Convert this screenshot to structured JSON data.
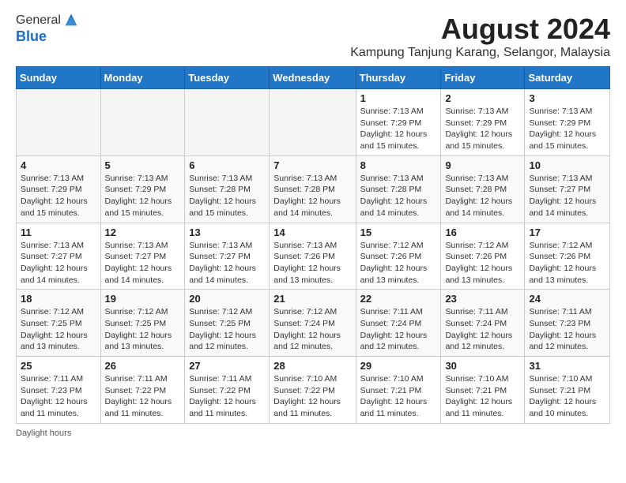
{
  "header": {
    "logo_general": "General",
    "logo_blue": "Blue",
    "title": "August 2024",
    "subtitle": "Kampung Tanjung Karang, Selangor, Malaysia"
  },
  "days_of_week": [
    "Sunday",
    "Monday",
    "Tuesday",
    "Wednesday",
    "Thursday",
    "Friday",
    "Saturday"
  ],
  "footer": {
    "daylight_label": "Daylight hours"
  },
  "weeks": [
    [
      {
        "day": "",
        "sunrise": "",
        "sunset": "",
        "daylight": "",
        "empty": true
      },
      {
        "day": "",
        "sunrise": "",
        "sunset": "",
        "daylight": "",
        "empty": true
      },
      {
        "day": "",
        "sunrise": "",
        "sunset": "",
        "daylight": "",
        "empty": true
      },
      {
        "day": "",
        "sunrise": "",
        "sunset": "",
        "daylight": "",
        "empty": true
      },
      {
        "day": "1",
        "sunrise": "7:13 AM",
        "sunset": "7:29 PM",
        "daylight": "12 hours and 15 minutes."
      },
      {
        "day": "2",
        "sunrise": "7:13 AM",
        "sunset": "7:29 PM",
        "daylight": "12 hours and 15 minutes."
      },
      {
        "day": "3",
        "sunrise": "7:13 AM",
        "sunset": "7:29 PM",
        "daylight": "12 hours and 15 minutes."
      }
    ],
    [
      {
        "day": "4",
        "sunrise": "7:13 AM",
        "sunset": "7:29 PM",
        "daylight": "12 hours and 15 minutes."
      },
      {
        "day": "5",
        "sunrise": "7:13 AM",
        "sunset": "7:29 PM",
        "daylight": "12 hours and 15 minutes."
      },
      {
        "day": "6",
        "sunrise": "7:13 AM",
        "sunset": "7:28 PM",
        "daylight": "12 hours and 15 minutes."
      },
      {
        "day": "7",
        "sunrise": "7:13 AM",
        "sunset": "7:28 PM",
        "daylight": "12 hours and 14 minutes."
      },
      {
        "day": "8",
        "sunrise": "7:13 AM",
        "sunset": "7:28 PM",
        "daylight": "12 hours and 14 minutes."
      },
      {
        "day": "9",
        "sunrise": "7:13 AM",
        "sunset": "7:28 PM",
        "daylight": "12 hours and 14 minutes."
      },
      {
        "day": "10",
        "sunrise": "7:13 AM",
        "sunset": "7:27 PM",
        "daylight": "12 hours and 14 minutes."
      }
    ],
    [
      {
        "day": "11",
        "sunrise": "7:13 AM",
        "sunset": "7:27 PM",
        "daylight": "12 hours and 14 minutes."
      },
      {
        "day": "12",
        "sunrise": "7:13 AM",
        "sunset": "7:27 PM",
        "daylight": "12 hours and 14 minutes."
      },
      {
        "day": "13",
        "sunrise": "7:13 AM",
        "sunset": "7:27 PM",
        "daylight": "12 hours and 14 minutes."
      },
      {
        "day": "14",
        "sunrise": "7:13 AM",
        "sunset": "7:26 PM",
        "daylight": "12 hours and 13 minutes."
      },
      {
        "day": "15",
        "sunrise": "7:12 AM",
        "sunset": "7:26 PM",
        "daylight": "12 hours and 13 minutes."
      },
      {
        "day": "16",
        "sunrise": "7:12 AM",
        "sunset": "7:26 PM",
        "daylight": "12 hours and 13 minutes."
      },
      {
        "day": "17",
        "sunrise": "7:12 AM",
        "sunset": "7:26 PM",
        "daylight": "12 hours and 13 minutes."
      }
    ],
    [
      {
        "day": "18",
        "sunrise": "7:12 AM",
        "sunset": "7:25 PM",
        "daylight": "12 hours and 13 minutes."
      },
      {
        "day": "19",
        "sunrise": "7:12 AM",
        "sunset": "7:25 PM",
        "daylight": "12 hours and 13 minutes."
      },
      {
        "day": "20",
        "sunrise": "7:12 AM",
        "sunset": "7:25 PM",
        "daylight": "12 hours and 12 minutes."
      },
      {
        "day": "21",
        "sunrise": "7:12 AM",
        "sunset": "7:24 PM",
        "daylight": "12 hours and 12 minutes."
      },
      {
        "day": "22",
        "sunrise": "7:11 AM",
        "sunset": "7:24 PM",
        "daylight": "12 hours and 12 minutes."
      },
      {
        "day": "23",
        "sunrise": "7:11 AM",
        "sunset": "7:24 PM",
        "daylight": "12 hours and 12 minutes."
      },
      {
        "day": "24",
        "sunrise": "7:11 AM",
        "sunset": "7:23 PM",
        "daylight": "12 hours and 12 minutes."
      }
    ],
    [
      {
        "day": "25",
        "sunrise": "7:11 AM",
        "sunset": "7:23 PM",
        "daylight": "12 hours and 11 minutes."
      },
      {
        "day": "26",
        "sunrise": "7:11 AM",
        "sunset": "7:22 PM",
        "daylight": "12 hours and 11 minutes."
      },
      {
        "day": "27",
        "sunrise": "7:11 AM",
        "sunset": "7:22 PM",
        "daylight": "12 hours and 11 minutes."
      },
      {
        "day": "28",
        "sunrise": "7:10 AM",
        "sunset": "7:22 PM",
        "daylight": "12 hours and 11 minutes."
      },
      {
        "day": "29",
        "sunrise": "7:10 AM",
        "sunset": "7:21 PM",
        "daylight": "12 hours and 11 minutes."
      },
      {
        "day": "30",
        "sunrise": "7:10 AM",
        "sunset": "7:21 PM",
        "daylight": "12 hours and 11 minutes."
      },
      {
        "day": "31",
        "sunrise": "7:10 AM",
        "sunset": "7:21 PM",
        "daylight": "12 hours and 10 minutes."
      }
    ]
  ]
}
